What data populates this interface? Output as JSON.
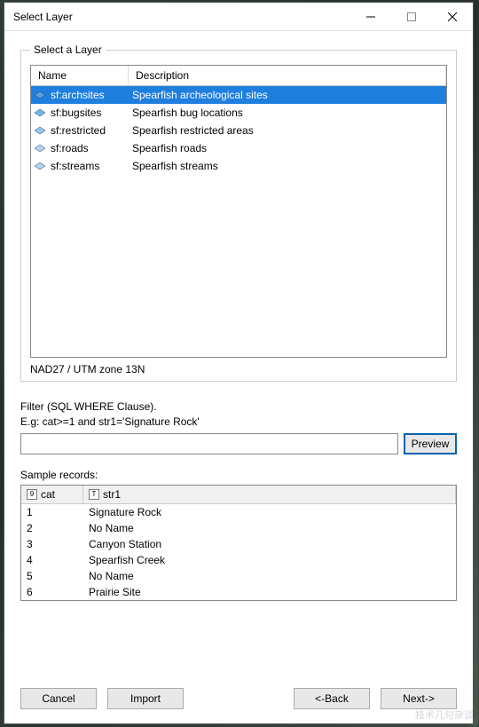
{
  "window": {
    "title": "Select Layer"
  },
  "group": {
    "legend": "Select a Layer"
  },
  "layerTable": {
    "headers": {
      "name": "Name",
      "description": "Description"
    },
    "rows": [
      {
        "name": "sf:archsites",
        "description": "Spearfish archeological sites",
        "selected": true,
        "iconColor": "#5aa0dd"
      },
      {
        "name": "sf:bugsites",
        "description": "Spearfish bug locations",
        "selected": false,
        "iconColor": "#6eb8e8"
      },
      {
        "name": "sf:restricted",
        "description": "Spearfish restricted areas",
        "selected": false,
        "iconColor": "#8fc7ee"
      },
      {
        "name": "sf:roads",
        "description": "Spearfish roads",
        "selected": false,
        "iconColor": "#b0d6f2"
      },
      {
        "name": "sf:streams",
        "description": "Spearfish streams",
        "selected": false,
        "iconColor": "#b0d6f2"
      }
    ],
    "crs": "NAD27 / UTM zone 13N"
  },
  "filter": {
    "label1": "Filter (SQL WHERE Clause).",
    "label2": "E.g: cat>=1 and str1='Signature Rock'",
    "value": "",
    "previewLabel": "Preview"
  },
  "sample": {
    "label": "Sample records:",
    "headers": {
      "cat": "cat",
      "str1": "str1"
    },
    "rows": [
      {
        "cat": "1",
        "str1": "Signature Rock"
      },
      {
        "cat": "2",
        "str1": "No Name"
      },
      {
        "cat": "3",
        "str1": "Canyon Station"
      },
      {
        "cat": "4",
        "str1": "Spearfish Creek"
      },
      {
        "cat": "5",
        "str1": "No Name"
      },
      {
        "cat": "6",
        "str1": "Prairie Site"
      }
    ]
  },
  "buttons": {
    "cancel": "Cancel",
    "import": "Import",
    "back": "<-Back",
    "next": "Next->"
  },
  "watermark": "技术几句杂谈"
}
